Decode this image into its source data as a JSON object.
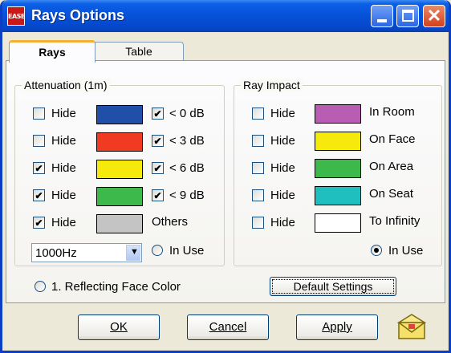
{
  "window": {
    "title": "Rays Options",
    "app_icon_text": "EASE"
  },
  "tabs": [
    {
      "label": "Rays",
      "active": true
    },
    {
      "label": "Table",
      "active": false
    }
  ],
  "attenuation": {
    "title": "Attenuation (1m)",
    "rows": [
      {
        "hide_label": "Hide",
        "hide_checked": false,
        "color": "#1f4fa8",
        "range_checked": true,
        "range_label": "< 0 dB"
      },
      {
        "hide_label": "Hide",
        "hide_checked": false,
        "color": "#f03a22",
        "range_checked": true,
        "range_label": "< 3 dB"
      },
      {
        "hide_label": "Hide",
        "hide_checked": true,
        "color": "#f5ea0c",
        "range_checked": true,
        "range_label": "< 6 dB"
      },
      {
        "hide_label": "Hide",
        "hide_checked": true,
        "color": "#3cb94a",
        "range_checked": true,
        "range_label": "< 9 dB"
      },
      {
        "hide_label": "Hide",
        "hide_checked": true,
        "color": "#c4c4c4",
        "range_label": "Others"
      }
    ],
    "frequency_select": "1000Hz",
    "in_use_label": "In Use",
    "in_use_selected": false
  },
  "ray_impact": {
    "title": "Ray Impact",
    "rows": [
      {
        "hide_label": "Hide",
        "hide_checked": false,
        "color": "#b85db3",
        "label": "In Room"
      },
      {
        "hide_label": "Hide",
        "hide_checked": false,
        "color": "#f5ea0c",
        "label": "On Face"
      },
      {
        "hide_label": "Hide",
        "hide_checked": false,
        "color": "#3cb94a",
        "label": "On Area"
      },
      {
        "hide_label": "Hide",
        "hide_checked": false,
        "color": "#1fbfbf",
        "label": "On Seat"
      },
      {
        "hide_label": "Hide",
        "hide_checked": false,
        "color": "#ffffff",
        "label": "To Infinity"
      }
    ],
    "in_use_label": "In Use",
    "in_use_selected": true
  },
  "reflecting_face_label": "1. Reflecting Face Color",
  "reflecting_face_selected": false,
  "default_settings_label": "Default Settings",
  "buttons": {
    "ok": "OK",
    "cancel": "Cancel",
    "apply": "Apply"
  },
  "icons": {
    "envelope": "envelope-icon"
  }
}
